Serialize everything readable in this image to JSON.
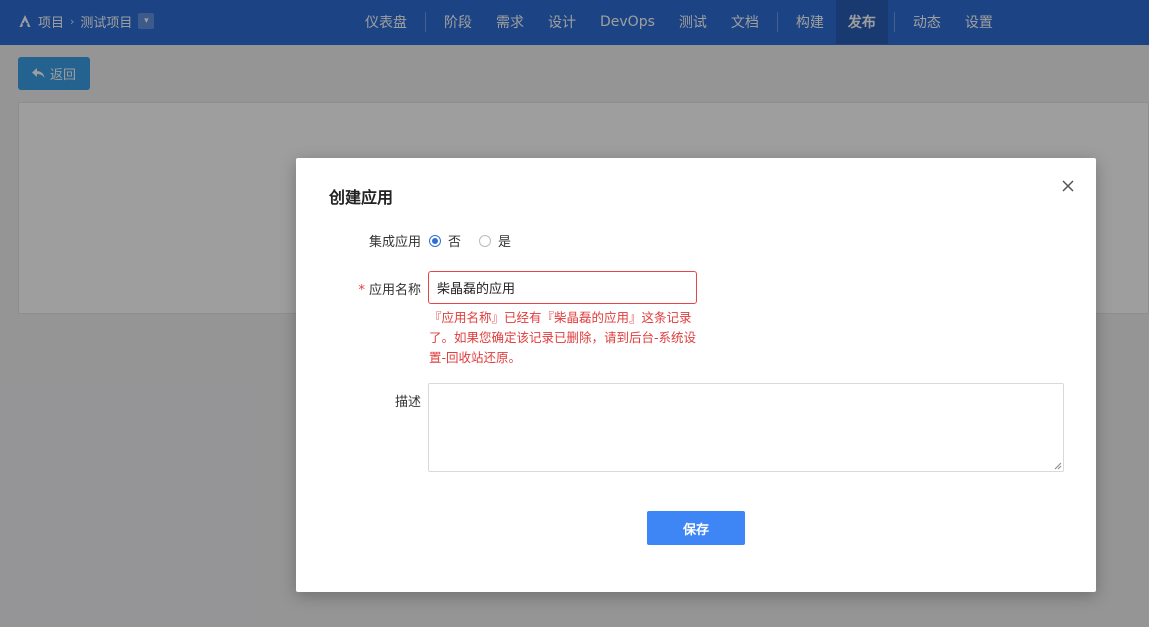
{
  "breadcrumb": {
    "root": "项目",
    "project": "测试项目"
  },
  "nav": {
    "items": [
      {
        "label": "仪表盘"
      },
      {
        "label": "阶段"
      },
      {
        "label": "需求"
      },
      {
        "label": "设计"
      },
      {
        "label": "DevOps"
      },
      {
        "label": "测试"
      },
      {
        "label": "文档"
      },
      {
        "label": "构建"
      },
      {
        "label": "发布",
        "active": true
      },
      {
        "label": "动态"
      },
      {
        "label": "设置"
      }
    ]
  },
  "page": {
    "back_label": "返回"
  },
  "modal": {
    "title": "创建应用",
    "integrated_label": "集成应用",
    "radio_no": "否",
    "radio_yes": "是",
    "radio_selected": "否",
    "name_label": "应用名称",
    "name_value": "柴晶磊的应用",
    "name_error": "『应用名称』已经有『柴晶磊的应用』这条记录了。如果您确定该记录已删除，请到后台-系统设置-回收站还原。",
    "desc_label": "描述",
    "desc_value": "",
    "save_label": "保存"
  },
  "colors": {
    "topbar": "#2e6fd6",
    "primary_button": "#3e86f5",
    "error": "#e03c3c"
  }
}
